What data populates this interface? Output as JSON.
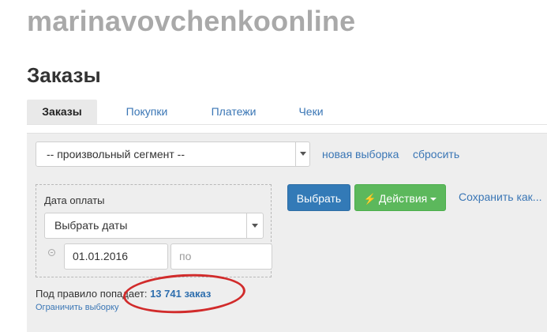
{
  "site": {
    "title": "marinavovchenkoonline"
  },
  "page": {
    "title": "Заказы"
  },
  "tabs": [
    {
      "label": "Заказы",
      "active": true
    },
    {
      "label": "Покупки",
      "active": false
    },
    {
      "label": "Платежи",
      "active": false
    },
    {
      "label": "Чеки",
      "active": false
    }
  ],
  "segment": {
    "selected": "-- произвольный сегмент --",
    "new_selection_label": "новая выборка",
    "reset_label": "сбросить"
  },
  "filter": {
    "date_label": "Дата оплаты",
    "date_select_value": "Выбрать даты",
    "date_from": "01.01.2016",
    "date_to_placeholder": "по"
  },
  "actions": {
    "select_label": "Выбрать",
    "actions_label": "Действия",
    "save_as_label": "Сохранить как..."
  },
  "rule": {
    "prefix": "Под правило попадает:",
    "count": "13 741 заказ",
    "limit_label": "Ограничить выборку"
  },
  "colors": {
    "link": "#3a76b5",
    "primary_button": "#337ab7",
    "success_button": "#5cb85c",
    "annotation": "#d12b2b"
  }
}
